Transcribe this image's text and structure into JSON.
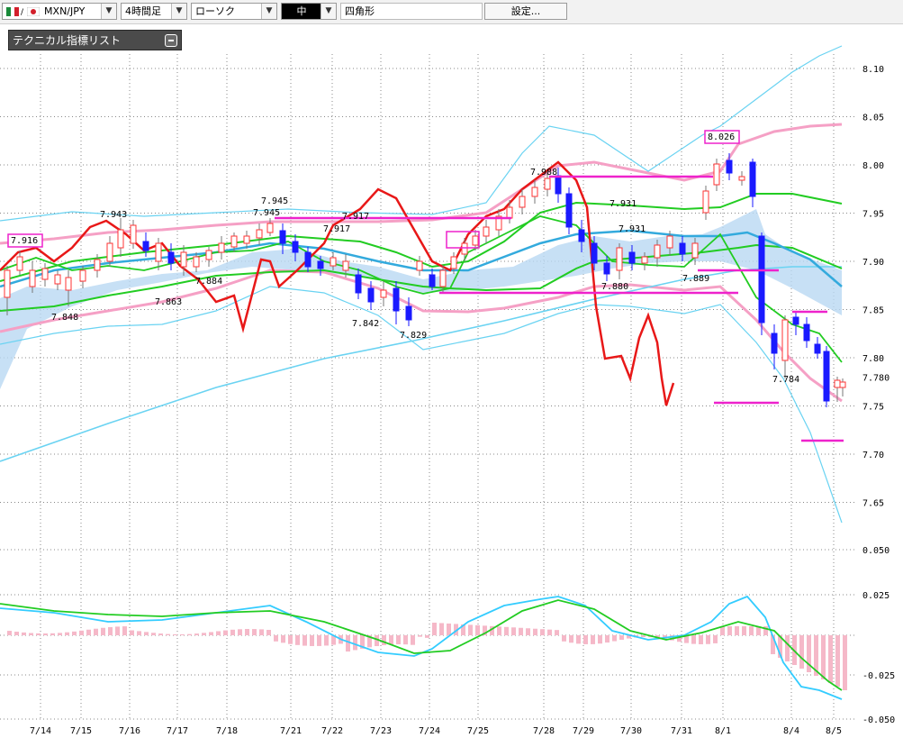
{
  "toolbar": {
    "symbol": "MXN/JPY",
    "timeframe": "4時間足",
    "chart_style": "ローソク",
    "size": "中",
    "shape": "四角形",
    "settings_label": "設定..."
  },
  "indicator_panel": {
    "title": "テクニカル指標リスト"
  },
  "colors": {
    "bull_candle": "#ff3333",
    "bear_candle": "#1a1aff",
    "bollinger": "#6ad3f2",
    "ma_green": "#22cc22",
    "ma_blue": "#33aadd",
    "pink_band": "#f5a0c5",
    "cloud": "#b9d8f3",
    "red_line": "#e81818",
    "magenta": "#ee22cc",
    "histogram": "#f5b8c8",
    "grid": "#888888"
  },
  "chart_data": {
    "type": "line",
    "price_axis": [
      "8.10",
      "8.05",
      "8.00",
      "7.95",
      "7.90",
      "7.85",
      "7.80",
      "7.75",
      "7.70",
      "7.65"
    ],
    "current_price": "7.780",
    "macd_axis": [
      "0.050",
      "0.025",
      "-0.025",
      "-0.050"
    ],
    "dates": [
      "7/14",
      "7/15",
      "7/16",
      "7/17",
      "7/18",
      "7/21",
      "7/22",
      "7/23",
      "7/24",
      "7/25",
      "7/28",
      "7/29",
      "7/30",
      "7/31",
      "8/1",
      "8/4",
      "8/5"
    ],
    "annotations": [
      {
        "label": "7.916",
        "boxed": true
      },
      {
        "label": "7.943",
        "boxed": false
      },
      {
        "label": "7.848",
        "boxed": false
      },
      {
        "label": "7.863",
        "boxed": false
      },
      {
        "label": "7.884",
        "boxed": false
      },
      {
        "label": "7.945",
        "boxed": false
      },
      {
        "label": "7.945",
        "boxed": false
      },
      {
        "label": "7.917",
        "boxed": false
      },
      {
        "label": "7.917",
        "boxed": false
      },
      {
        "label": "7.842",
        "boxed": false
      },
      {
        "label": "7.829",
        "boxed": false
      },
      {
        "label": "7.988",
        "boxed": false
      },
      {
        "label": "7.931",
        "boxed": false
      },
      {
        "label": "7.931",
        "boxed": false
      },
      {
        "label": "7.880",
        "boxed": false
      },
      {
        "label": "7.889",
        "boxed": false
      },
      {
        "label": "8.026",
        "boxed": true
      },
      {
        "label": "7.784",
        "boxed": false
      }
    ]
  }
}
